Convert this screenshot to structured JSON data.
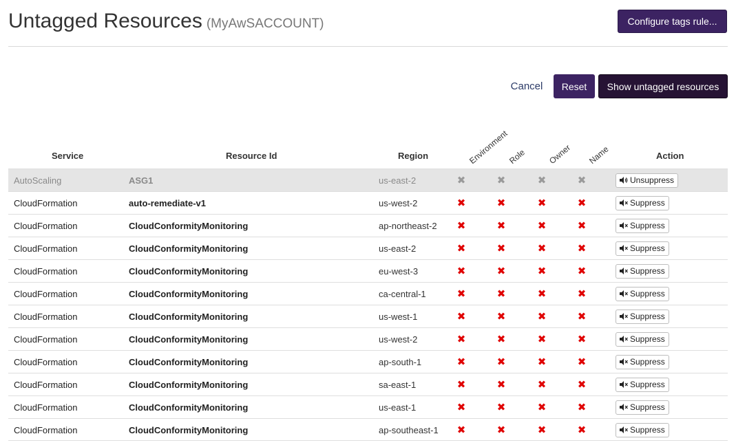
{
  "header": {
    "title": "Untagged Resources",
    "account": "(MyAwSACCOUNT)",
    "configure_label": "Configure tags rule..."
  },
  "toolbar": {
    "cancel_label": "Cancel",
    "reset_label": "Reset",
    "show_label": "Show untagged resources"
  },
  "table": {
    "columns": {
      "service": "Service",
      "resource_id": "Resource Id",
      "region": "Region",
      "tags": [
        "Environment",
        "Role",
        "Owner",
        "Name"
      ],
      "action": "Action"
    },
    "rows": [
      {
        "service": "AutoScaling",
        "resource_id": "ASG1",
        "region": "us-east-2",
        "action": "Unsuppress",
        "suppressed": true
      },
      {
        "service": "CloudFormation",
        "resource_id": "auto-remediate-v1",
        "region": "us-west-2",
        "action": "Suppress",
        "suppressed": false
      },
      {
        "service": "CloudFormation",
        "resource_id": "CloudConformityMonitoring",
        "region": "ap-northeast-2",
        "action": "Suppress",
        "suppressed": false
      },
      {
        "service": "CloudFormation",
        "resource_id": "CloudConformityMonitoring",
        "region": "us-east-2",
        "action": "Suppress",
        "suppressed": false
      },
      {
        "service": "CloudFormation",
        "resource_id": "CloudConformityMonitoring",
        "region": "eu-west-3",
        "action": "Suppress",
        "suppressed": false
      },
      {
        "service": "CloudFormation",
        "resource_id": "CloudConformityMonitoring",
        "region": "ca-central-1",
        "action": "Suppress",
        "suppressed": false
      },
      {
        "service": "CloudFormation",
        "resource_id": "CloudConformityMonitoring",
        "region": "us-west-1",
        "action": "Suppress",
        "suppressed": false
      },
      {
        "service": "CloudFormation",
        "resource_id": "CloudConformityMonitoring",
        "region": "us-west-2",
        "action": "Suppress",
        "suppressed": false
      },
      {
        "service": "CloudFormation",
        "resource_id": "CloudConformityMonitoring",
        "region": "ap-south-1",
        "action": "Suppress",
        "suppressed": false
      },
      {
        "service": "CloudFormation",
        "resource_id": "CloudConformityMonitoring",
        "region": "sa-east-1",
        "action": "Suppress",
        "suppressed": false
      },
      {
        "service": "CloudFormation",
        "resource_id": "CloudConformityMonitoring",
        "region": "us-east-1",
        "action": "Suppress",
        "suppressed": false
      },
      {
        "service": "CloudFormation",
        "resource_id": "CloudConformityMonitoring",
        "region": "ap-southeast-1",
        "action": "Suppress",
        "suppressed": false
      }
    ]
  },
  "icons": {
    "missing_tag": "cross-icon",
    "unsuppress": "speaker-on-icon",
    "suppress": "speaker-muted-icon"
  },
  "colors": {
    "primary": "#3c2362",
    "dark": "#261334",
    "missing_tag": "#e00000",
    "suppressed_row": "#e5e5e5"
  }
}
